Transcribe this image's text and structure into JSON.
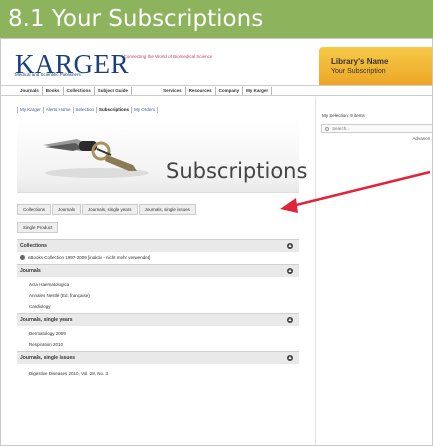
{
  "slide": {
    "title": "8.1 Your Subscriptions"
  },
  "header": {
    "logo": "KARGER",
    "tagline": "Connecting the World of Biomedical Science",
    "subtitle": "Medical and Scientific Publishers",
    "library_name": "Library's Name",
    "library_sub": "Your Subscription"
  },
  "nav": {
    "items": [
      "Journals",
      "Books",
      "Collections",
      "Subject Guide",
      "Services",
      "Resources",
      "Company",
      "My Karger"
    ]
  },
  "subnav": {
    "items": [
      "My Karger",
      "Alerts Home",
      "Selection",
      "Subscriptions",
      "My Orders"
    ]
  },
  "hero": {
    "title": "Subscriptions"
  },
  "tabs": {
    "items": [
      "Collections",
      "Journals",
      "Journals, single years",
      "Journals, single issues"
    ],
    "second": "Single Product"
  },
  "sections": [
    {
      "label": "Collections",
      "items": [
        "eBooks Collection 1997-2009 [inaktiv - nicht mehr verwendet]"
      ]
    },
    {
      "label": "Journals",
      "items": [
        "Acta Haematologica",
        "Annales Nestlé (Ed. française)",
        "Cardiology"
      ]
    },
    {
      "label": "Journals, single years",
      "items": [
        "Dermatology 2009",
        "Respiration 2010"
      ]
    },
    {
      "label": "Journals, single issues",
      "items": [
        "Digestive Diseases 2010, Vol. 28, No. 3"
      ]
    }
  ],
  "right": {
    "selection": "My Selection: 9 items",
    "search_placeholder": "Search...",
    "advanced": "Advance"
  },
  "colors": {
    "title_bar": "#8db35d",
    "accent": "#e0243a",
    "library_box": "#f0b232"
  }
}
